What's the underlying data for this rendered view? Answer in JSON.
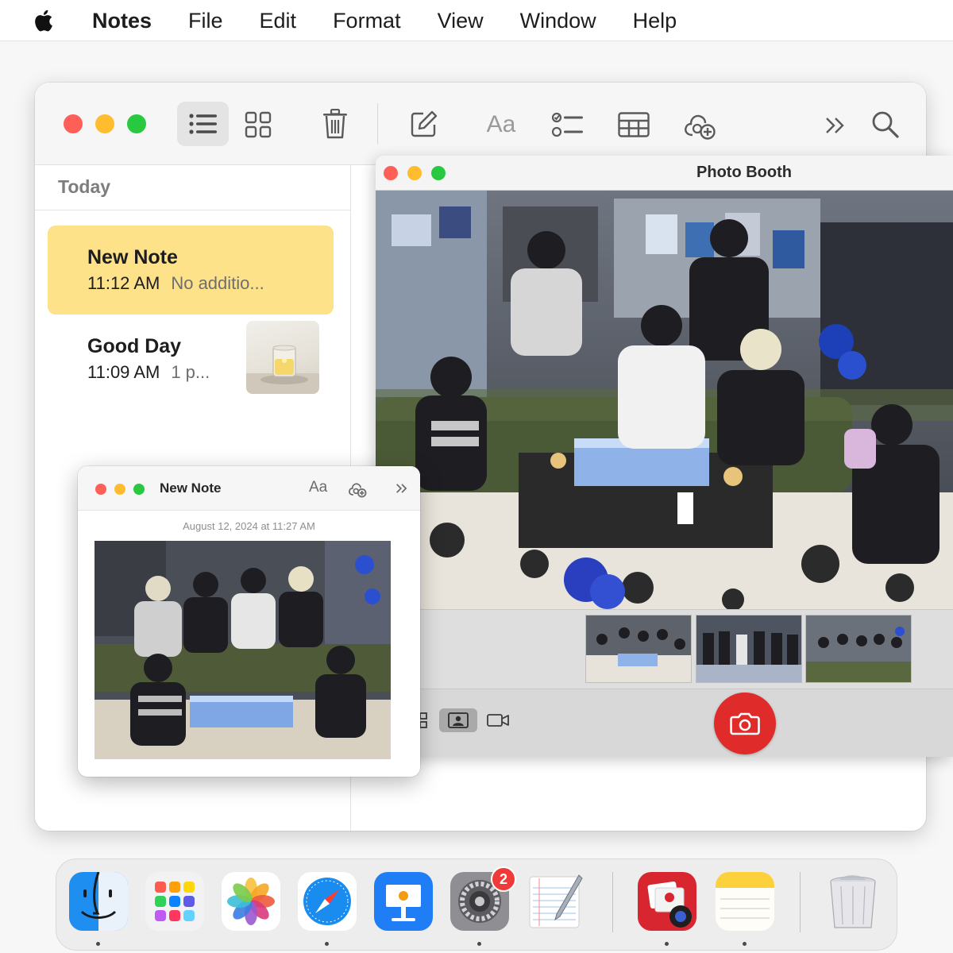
{
  "menubar": {
    "app_name": "Notes",
    "items": [
      "File",
      "Edit",
      "Format",
      "View",
      "Window",
      "Help"
    ]
  },
  "notes_window": {
    "toolbar": {
      "format_label": "Aa"
    },
    "sidebar": {
      "section": "Today",
      "notes": [
        {
          "title": "New Note",
          "time": "11:12 AM",
          "preview": "No additio...",
          "selected": true
        },
        {
          "title": "Good Day",
          "time": "11:09 AM",
          "preview": "1 p...",
          "selected": false
        }
      ]
    }
  },
  "photo_booth": {
    "title": "Photo Booth"
  },
  "mini_note": {
    "title": "New Note",
    "format_label": "Aa",
    "date": "August 12, 2024 at 11:27 AM"
  },
  "dock": {
    "apps": [
      "finder",
      "launchpad",
      "photos",
      "safari",
      "keynote",
      "system-settings",
      "textedit",
      "photo-booth",
      "notes",
      "trash"
    ],
    "settings_badge": "2"
  },
  "colors": {
    "note_selected": "#fde28a",
    "close": "#fe5f57",
    "minimize": "#febc2e",
    "zoom": "#28c840",
    "shutter": "#e02b2b"
  }
}
